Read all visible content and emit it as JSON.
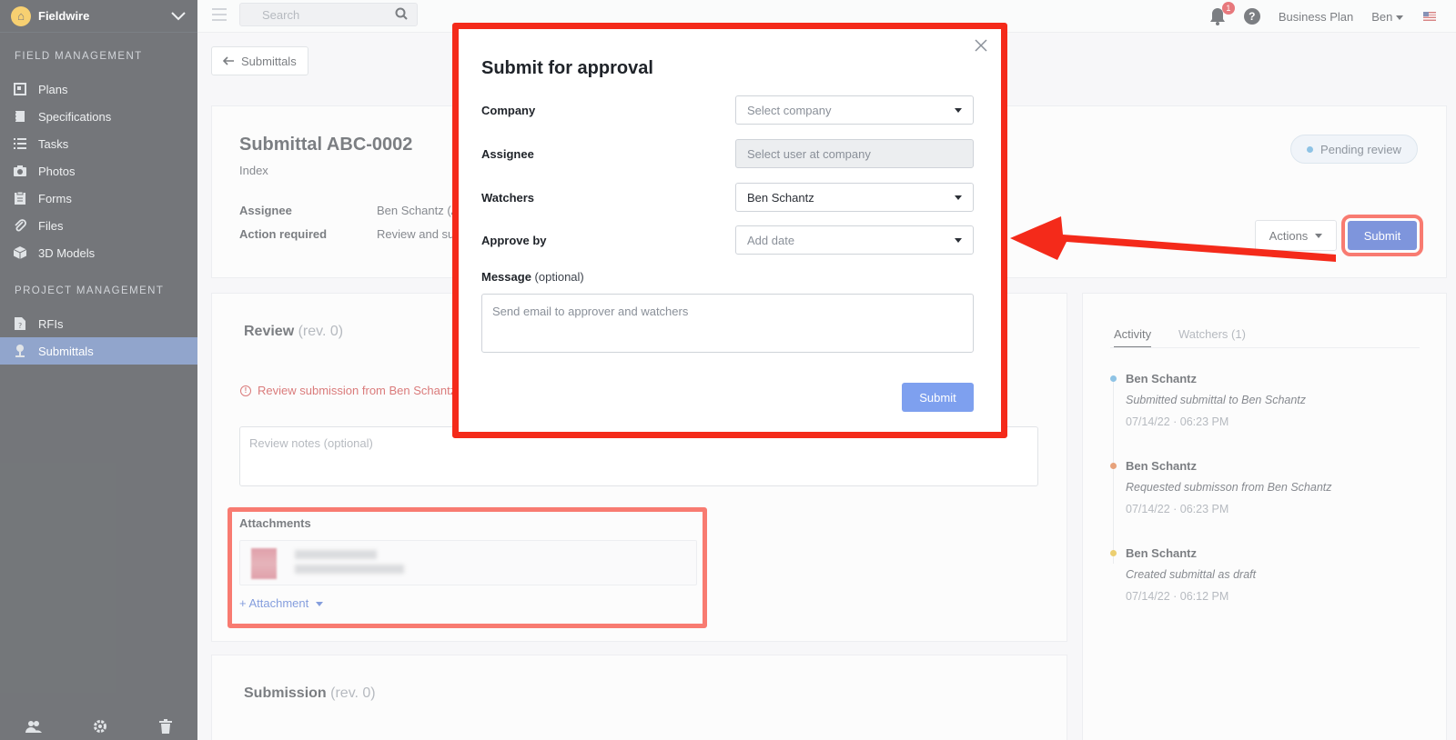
{
  "app": {
    "brand": "Fieldwire"
  },
  "sidebar": {
    "sections": [
      {
        "title": "FIELD MANAGEMENT",
        "items": [
          {
            "label": "Plans",
            "icon": "plans-icon"
          },
          {
            "label": "Specifications",
            "icon": "specifications-icon"
          },
          {
            "label": "Tasks",
            "icon": "tasks-icon"
          },
          {
            "label": "Photos",
            "icon": "camera-icon"
          },
          {
            "label": "Forms",
            "icon": "forms-icon"
          },
          {
            "label": "Files",
            "icon": "paperclip-icon"
          },
          {
            "label": "3D Models",
            "icon": "cube-icon"
          }
        ]
      },
      {
        "title": "PROJECT MANAGEMENT",
        "items": [
          {
            "label": "RFIs",
            "icon": "rfi-icon"
          },
          {
            "label": "Submittals",
            "icon": "submittals-icon",
            "active": true
          }
        ]
      }
    ]
  },
  "topbar": {
    "search_placeholder": "Search",
    "notification_count": "1",
    "help": "?",
    "plan": "Business Plan",
    "user": "Ben"
  },
  "page": {
    "back_button": "Submittals",
    "title": "Submittal ABC-0002",
    "subtitle": "Index",
    "assignee_label": "Assignee",
    "assignee_value": "Ben Schantz (A",
    "action_label": "Action required",
    "action_value": "Review and su",
    "status": "Pending review",
    "actions_button": "Actions",
    "submit_button": "Submit"
  },
  "review": {
    "title": "Review",
    "rev": "(rev. 0)",
    "alert": "Review submission from Ben Schantz",
    "notes_placeholder": "Review notes (optional)",
    "attachments_label": "Attachments",
    "add_attachment": "+ Attachment"
  },
  "submission": {
    "title": "Submission",
    "rev": "(rev. 0)"
  },
  "activity_panel": {
    "tabs": [
      "Activity",
      "Watchers (1)"
    ],
    "entries": [
      {
        "name": "Ben Schantz",
        "desc": "Submitted submittal to Ben Schantz",
        "time": "07/14/22 · 06:23 PM",
        "color": "#4a9fd6"
      },
      {
        "name": "Ben Schantz",
        "desc": "Requested submisson from Ben Schantz",
        "time": "07/14/22 · 06:23 PM",
        "color": "#d9692a"
      },
      {
        "name": "Ben Schantz",
        "desc": "Created submittal as draft",
        "time": "07/14/22 · 06:12 PM",
        "color": "#e0b21a"
      }
    ]
  },
  "modal": {
    "title": "Submit for approval",
    "company_label": "Company",
    "company_placeholder": "Select company",
    "assignee_label": "Assignee",
    "assignee_placeholder": "Select user at company",
    "watchers_label": "Watchers",
    "watchers_value": "Ben Schantz",
    "approve_label": "Approve by",
    "approve_placeholder": "Add date",
    "message_label": "Message",
    "message_optional": "(optional)",
    "message_placeholder": "Send email to approver and watchers",
    "submit": "Submit"
  },
  "colors": {
    "annotation": "#f42a1a",
    "primary": "#2f54c7",
    "sidebar_bg": "#1f2329",
    "sidebar_active": "#4e6fad"
  }
}
